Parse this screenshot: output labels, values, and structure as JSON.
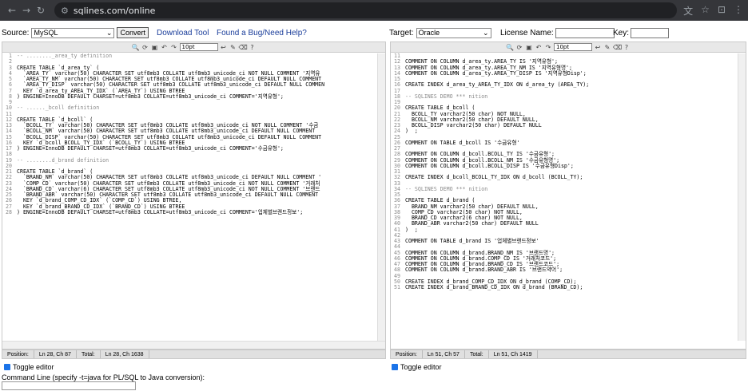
{
  "browser": {
    "url": "sqlines.com/online"
  },
  "top": {
    "source_label": "Source:",
    "source_value": "MySQL",
    "convert_label": "Convert",
    "download_label": "Download Tool",
    "bug_label": "Found a Bug/Need Help?",
    "target_label": "Target:",
    "target_value": "Oracle",
    "license_label": "License Name:",
    "key_label": "Key:"
  },
  "toolbar": {
    "font_size": "10pt"
  },
  "source_code": [
    {
      "n": "1",
      "t": "-- ........_area_ty definition"
    },
    {
      "n": "2",
      "t": ""
    },
    {
      "n": "3",
      "t": "CREATE TABLE `d_area_ty` ("
    },
    {
      "n": "4",
      "t": "  `AREA_TY` varchar(50) CHARACTER SET utf8mb3 COLLATE utf8mb3_unicode_ci NOT NULL COMMENT '지역유"
    },
    {
      "n": "5",
      "t": "  `AREA_TY_NM` varchar(50) CHARACTER SET utf8mb3 COLLATE utf8mb3_unicode_ci DEFAULT NULL COMMENT"
    },
    {
      "n": "6",
      "t": "  `AREA_TY_DISP` varchar(50) CHARACTER SET utf8mb3 COLLATE utf8mb3_unicode_ci DEFAULT NULL COMMEN"
    },
    {
      "n": "7",
      "t": "  KEY `d_area_ty_AREA_TY_IDX` (`AREA_TY`) USING BTREE"
    },
    {
      "n": "8",
      "t": ") ENGINE=InnoDB DEFAULT CHARSET=utf8mb3 COLLATE=utf8mb3_unicode_ci COMMENT='지역유형';"
    },
    {
      "n": "9",
      "t": ""
    },
    {
      "n": "10",
      "t": "-- ......_bcoll definition"
    },
    {
      "n": "11",
      "t": ""
    },
    {
      "n": "12",
      "t": "CREATE TABLE `d_bcoll` ("
    },
    {
      "n": "13",
      "t": "  `BCOLL_TY` varchar(50) CHARACTER SET utf8mb3 COLLATE utf8mb3_unicode_ci NOT NULL COMMENT '수금"
    },
    {
      "n": "14",
      "t": "  `BCOLL_NM` varchar(50) CHARACTER SET utf8mb3 COLLATE utf8mb3_unicode_ci DEFAULT NULL COMMENT"
    },
    {
      "n": "15",
      "t": "  `BCOLL_DISP` varchar(50) CHARACTER SET utf8mb3 COLLATE utf8mb3_unicode_ci DEFAULT NULL COMMENT"
    },
    {
      "n": "16",
      "t": "  KEY `d_bcoll_BCOLL_TY_IDX` (`BCOLL_TY`) USING BTREE"
    },
    {
      "n": "17",
      "t": ") ENGINE=InnoDB DEFAULT CHARSET=utf8mb3 COLLATE=utf8mb3_unicode_ci COMMENT='수금유형';"
    },
    {
      "n": "18",
      "t": ""
    },
    {
      "n": "19",
      "t": "-- ........d_brand definition"
    },
    {
      "n": "20",
      "t": ""
    },
    {
      "n": "21",
      "t": "CREATE TABLE `d_brand` ("
    },
    {
      "n": "22",
      "t": "  `BRAND_NM` varchar(50) CHARACTER SET utf8mb3 COLLATE utf8mb3_unicode_ci DEFAULT NULL COMMENT '"
    },
    {
      "n": "23",
      "t": "  `COMP_CD` varchar(50) CHARACTER SET utf8mb3 COLLATE utf8mb3_unicode_ci NOT NULL COMMENT '거래처"
    },
    {
      "n": "24",
      "t": "  `BRAND_CD` varchar(6) CHARACTER SET utf8mb3 COLLATE utf8mb3_unicode_ci NOT NULL COMMENT '브랜드"
    },
    {
      "n": "25",
      "t": "  `BRAND_ABR` varchar(50) CHARACTER SET utf8mb3 COLLATE utf8mb3_unicode_ci DEFAULT NULL COMMENT"
    },
    {
      "n": "26",
      "t": "  KEY `d_brand_COMP_CD_IDX` (`COMP_CD`) USING BTREE,"
    },
    {
      "n": "27",
      "t": "  KEY `d_brand_BRAND_CD_IDX` (`BRAND_CD`) USING BTREE"
    },
    {
      "n": "28",
      "t": ") ENGINE=InnoDB DEFAULT CHARSET=utf8mb3 COLLATE=utf8mb3_unicode_ci COMMENT='업체별브랜드정보';"
    }
  ],
  "target_code": [
    {
      "n": "11",
      "t": ""
    },
    {
      "n": "12",
      "t": "COMMENT ON COLUMN d_area_ty.AREA_TY IS '지역유형';"
    },
    {
      "n": "13",
      "t": "COMMENT ON COLUMN d_area_ty.AREA_TY_NM IS '지역유형명';"
    },
    {
      "n": "14",
      "t": "COMMENT ON COLUMN d_area_ty.AREA_TY_DISP IS '지역유형Disp';"
    },
    {
      "n": "15",
      "t": ""
    },
    {
      "n": "16",
      "t": "CREATE INDEX d_area_ty_AREA_TY_IDX ON d_area_ty (AREA_TY);"
    },
    {
      "n": "17",
      "t": ""
    },
    {
      "n": "18",
      "t": "-- SQLINES DEMO *** nition"
    },
    {
      "n": "19",
      "t": ""
    },
    {
      "n": "20",
      "t": "CREATE TABLE d_bcoll ("
    },
    {
      "n": "21",
      "t": "  BCOLL_TY varchar2(50 char) NOT NULL,"
    },
    {
      "n": "22",
      "t": "  BCOLL_NM varchar2(50 char) DEFAULT NULL,"
    },
    {
      "n": "23",
      "t": "  BCOLL_DISP varchar2(50 char) DEFAULT NULL"
    },
    {
      "n": "24",
      "t": ")  ;"
    },
    {
      "n": "25",
      "t": ""
    },
    {
      "n": "26",
      "t": "COMMENT ON TABLE d_bcoll IS '수금유형'"
    },
    {
      "n": "27",
      "t": ""
    },
    {
      "n": "28",
      "t": "COMMENT ON COLUMN d_bcoll.BCOLL_TY IS '수금유형';"
    },
    {
      "n": "29",
      "t": "COMMENT ON COLUMN d_bcoll.BCOLL_NM IS '수금유형명';"
    },
    {
      "n": "30",
      "t": "COMMENT ON COLUMN d_bcoll.BCOLL_DISP IS '수금유형Disp';"
    },
    {
      "n": "31",
      "t": ""
    },
    {
      "n": "32",
      "t": "CREATE INDEX d_bcoll_BCOLL_TY_IDX ON d_bcoll (BCOLL_TY);"
    },
    {
      "n": "33",
      "t": ""
    },
    {
      "n": "34",
      "t": "-- SQLINES DEMO *** nition"
    },
    {
      "n": "35",
      "t": ""
    },
    {
      "n": "36",
      "t": "CREATE TABLE d_brand ("
    },
    {
      "n": "37",
      "t": "  BRAND_NM varchar2(50 char) DEFAULT NULL,"
    },
    {
      "n": "38",
      "t": "  COMP_CD varchar2(50 char) NOT NULL,"
    },
    {
      "n": "39",
      "t": "  BRAND_CD varchar2(6 char) NOT NULL,"
    },
    {
      "n": "40",
      "t": "  BRAND_ABR varchar2(50 char) DEFAULT NULL"
    },
    {
      "n": "41",
      "t": ")  ;"
    },
    {
      "n": "42",
      "t": ""
    },
    {
      "n": "43",
      "t": "COMMENT ON TABLE d_brand IS '업체별브랜드정보'"
    },
    {
      "n": "44",
      "t": ""
    },
    {
      "n": "45",
      "t": "COMMENT ON COLUMN d_brand.BRAND_NM IS '브랜드명';"
    },
    {
      "n": "46",
      "t": "COMMENT ON COLUMN d_brand.COMP_CD IS '거래처코드';"
    },
    {
      "n": "47",
      "t": "COMMENT ON COLUMN d_brand.BRAND_CD IS '브랜드코드';"
    },
    {
      "n": "48",
      "t": "COMMENT ON COLUMN d_brand.BRAND_ABR IS '브랜드약어';"
    },
    {
      "n": "49",
      "t": ""
    },
    {
      "n": "50",
      "t": "CREATE INDEX d_brand_COMP_CD_IDX ON d_brand (COMP_CD);"
    },
    {
      "n": "51",
      "t": "CREATE INDEX d_brand_BRAND_CD_IDX ON d_brand (BRAND_CD);"
    }
  ],
  "source_status": {
    "position_label": "Position:",
    "position_value": "Ln 28, Ch 87",
    "total_label": "Total:",
    "total_value": "Ln 28, Ch 1638"
  },
  "target_status": {
    "position_label": "Position:",
    "position_value": "Ln 51, Ch 57",
    "total_label": "Total:",
    "total_value": "Ln 51, Ch 1419"
  },
  "toggle_label": "Toggle editor",
  "command_label": "Command Line (specify -t=java for PL/SQL to Java conversion):"
}
